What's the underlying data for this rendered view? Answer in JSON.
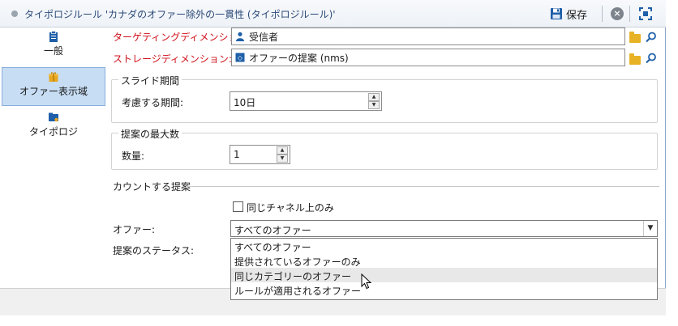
{
  "window": {
    "title": "タイポロジルール 'カナダのオファー除外の一貫性 (タイポロジルール)'",
    "save_label": "保存"
  },
  "sidebar": {
    "items": [
      {
        "label": "一般",
        "icon": "clipboard-icon",
        "active": false
      },
      {
        "label": "オファー表示域",
        "icon": "gift-icon",
        "active": true
      },
      {
        "label": "タイポロジ",
        "icon": "folder-user-icon",
        "active": false
      }
    ]
  },
  "form": {
    "targeting_label": "ターゲティングディメンション:",
    "targeting_value": "受信者",
    "storage_label": "ストレージディメンション:",
    "storage_value": "オファーの提案 (nms)",
    "slide_period": {
      "title": "スライド期間",
      "period_label": "考慮する期間:",
      "period_value": "10日"
    },
    "max_proposals": {
      "title": "提案の最大数",
      "qty_label": "数量:",
      "qty_value": "1"
    },
    "counted": {
      "title": "カウントする提案",
      "same_channel_label": "同じチャネル上のみ",
      "same_channel_checked": false,
      "offer_label": "オファー:",
      "offer_selected": "すべてのオファー",
      "status_label": "提案のステータス:",
      "offer_options": [
        "すべてのオファー",
        "提供されているオファーのみ",
        "同じカテゴリーのオファー",
        "ルールが適用されるオファー"
      ],
      "hover_index": 2
    }
  }
}
